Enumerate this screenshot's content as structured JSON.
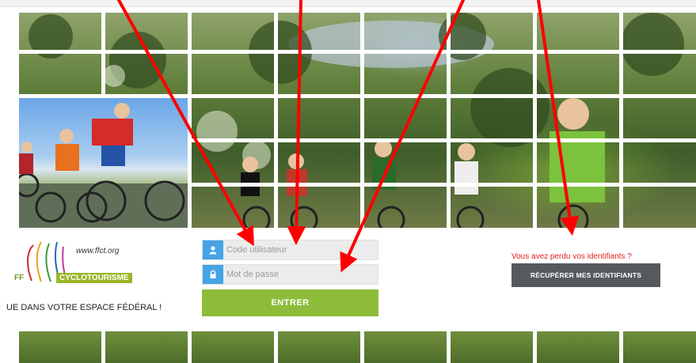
{
  "colors": {
    "accent_blue": "#45a3e6",
    "enter_green": "#8cbc3a",
    "recover_gray": "#555a5f",
    "alert_red": "#e02020",
    "annotation_red": "#ff0000"
  },
  "logo": {
    "url": "www.ffct.org",
    "ff": "FF",
    "name": "CYCLOTOURISME"
  },
  "tagline": "UE DANS VOTRE ESPACE FÉDÉRAL !",
  "login": {
    "user_placeholder": "Code utilisateur",
    "password_placeholder": "Mot de passe",
    "user_icon": "user-icon",
    "lock_icon": "lock-icon",
    "submit_label": "ENTRER"
  },
  "recover": {
    "prompt": "Vous avez perdu vos identifiants ?",
    "button_label": "RÉCUPÉRER MES IDENTIFIANTS"
  }
}
